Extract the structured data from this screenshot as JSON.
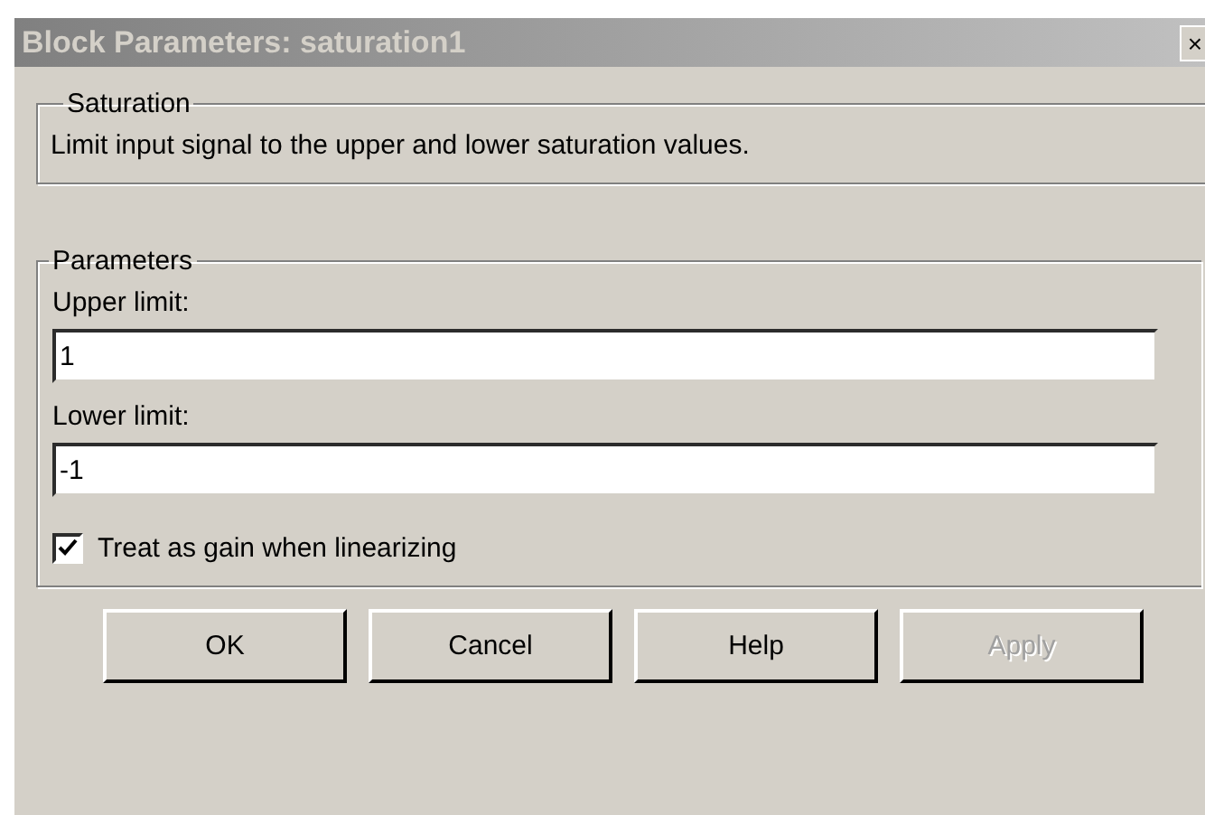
{
  "window": {
    "title": "Block Parameters: saturation1",
    "close": "×"
  },
  "description_group": {
    "title": "Saturation",
    "text": "Limit input signal to the upper and lower saturation values."
  },
  "parameters_group": {
    "title": "Parameters",
    "fields": [
      {
        "label": "Upper limit:",
        "value": "1"
      },
      {
        "label": "Lower limit:",
        "value": "-1"
      }
    ],
    "checkbox": {
      "label": "Treat as gain when linearizing",
      "checked": true
    }
  },
  "buttons": [
    {
      "label": "OK",
      "disabled": false
    },
    {
      "label": "Cancel",
      "disabled": false
    },
    {
      "label": "Help",
      "disabled": false
    },
    {
      "label": "Apply",
      "disabled": true
    }
  ]
}
